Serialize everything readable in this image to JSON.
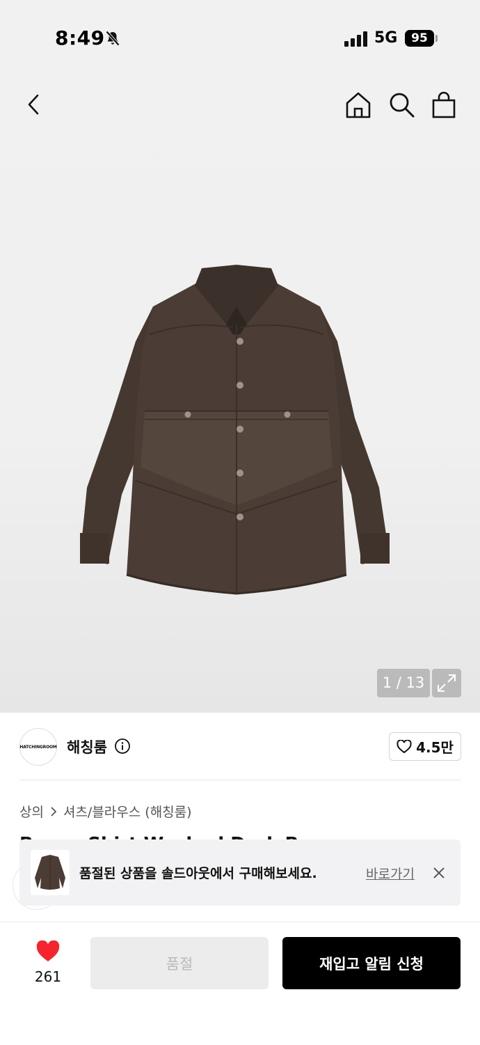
{
  "status_bar": {
    "time": "8:49",
    "network": "5G",
    "battery": "95"
  },
  "gallery": {
    "counter": "1 / 13"
  },
  "brand": {
    "logo_text": "HATCHINGROOM",
    "name": "해칭룸",
    "likes": "4.5만"
  },
  "breadcrumb": {
    "category": "상의",
    "subcategory": "셔츠/블라우스 (해칭룸)"
  },
  "product": {
    "title_partial": "Bacon Shirt Washed Dark Brown"
  },
  "toast": {
    "message": "품절된 상품을 솔드아웃에서 구매해보세요.",
    "link_label": "바로가기"
  },
  "bottom_bar": {
    "wish_count": "261",
    "soldout_label": "품절",
    "restock_label": "재입고 알림 신청"
  },
  "colors": {
    "heart_red": "#f5242d",
    "shirt_brown": "#4b3d35",
    "cta_black": "#000000"
  }
}
